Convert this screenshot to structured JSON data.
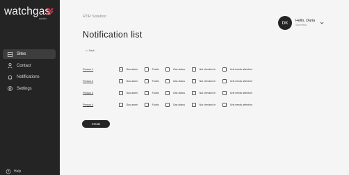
{
  "brand": {
    "name": "watchgas",
    "tagline": "solution",
    "mark_color": "#e23b4a"
  },
  "sidebar": {
    "items": [
      {
        "label": "Sites",
        "icon": "grid-icon"
      },
      {
        "label": "Contact",
        "icon": "person-icon"
      },
      {
        "label": "Notifications",
        "icon": "bell-icon"
      },
      {
        "label": "Settings",
        "icon": "gear-icon"
      }
    ],
    "active_item": "Sites",
    "help_label": "Help"
  },
  "header": {
    "app_title": "RTR Solution",
    "page_title": "Notification list",
    "back_link": "< / Back"
  },
  "user": {
    "initials": "DK",
    "greeting": "Hello, Daria",
    "role": "Supervisor"
  },
  "options_labels": [
    "Gas alarm",
    "Faults",
    "Gas status",
    "Not checked in",
    "Unit needs attention"
  ],
  "people": [
    {
      "name": "Person 1",
      "checked": [
        true,
        false,
        false,
        false,
        false
      ]
    },
    {
      "name": "Person 2",
      "checked": [
        false,
        false,
        false,
        false,
        false
      ]
    },
    {
      "name": "Person 3",
      "checked": [
        false,
        false,
        false,
        false,
        false
      ]
    },
    {
      "name": "Person 4",
      "checked": [
        false,
        false,
        false,
        false,
        false
      ]
    }
  ],
  "create_label": "Create"
}
